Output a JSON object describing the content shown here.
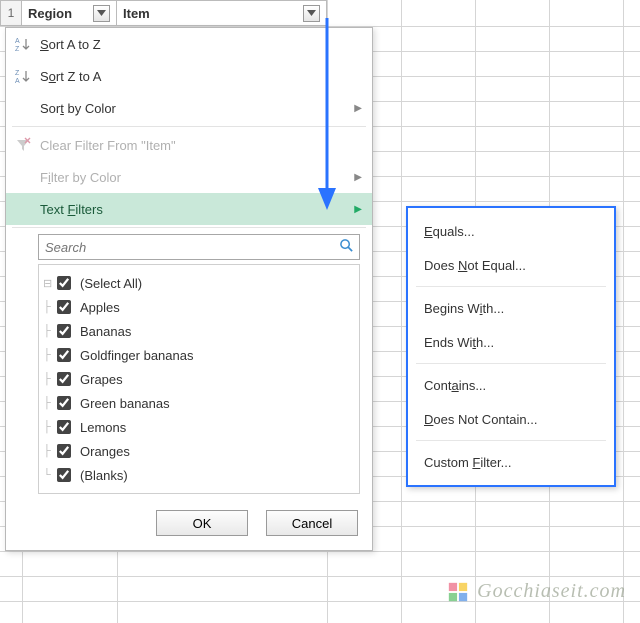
{
  "header": {
    "row_num": "1",
    "col_region": "Region",
    "col_item": "Item"
  },
  "panel": {
    "sort_az": "Sort A to Z",
    "sort_za": "Sort Z to A",
    "sort_color": "Sort by Color",
    "clear_filter": "Clear Filter From \"Item\"",
    "filter_color": "Filter by Color",
    "text_filters": "Text Filters",
    "search_placeholder": "Search",
    "checklist": [
      "(Select All)",
      "Apples",
      "Bananas",
      "Goldfinger bananas",
      "Grapes",
      "Green bananas",
      "Lemons",
      "Oranges",
      "(Blanks)"
    ],
    "ok": "OK",
    "cancel": "Cancel"
  },
  "submenu": {
    "equals": "Equals...",
    "not_equal": "Does Not Equal...",
    "begins": "Begins With...",
    "ends": "Ends With...",
    "contains": "Contains...",
    "not_contain": "Does Not Contain...",
    "custom": "Custom Filter..."
  },
  "watermark": {
    "text": "Gocchiaseit.com"
  },
  "colors": {
    "highlight": "#c9e8d9",
    "submenu_border": "#2a73ff",
    "arrow": "#2a73ff"
  }
}
